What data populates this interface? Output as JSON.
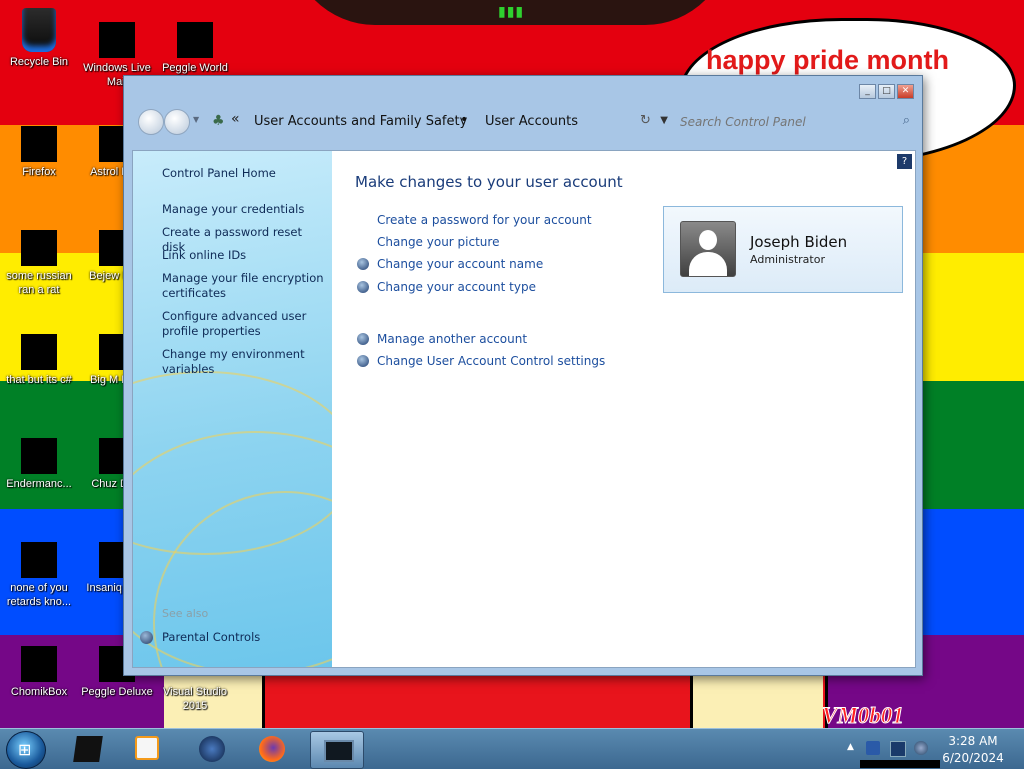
{
  "wallpaper": {
    "speech_text": "happy pride month",
    "signature": "VM0b01"
  },
  "desktop_icons": [
    {
      "label": "Recycle Bin",
      "icon": "recycle-bin-icon"
    },
    {
      "label": "Windows Live Mail",
      "icon": "mail-icon"
    },
    {
      "label": "Peggle World",
      "icon": "game-icon"
    },
    {
      "label": "Firefox",
      "icon": "firefox-icon"
    },
    {
      "label": "Astrol Delu",
      "icon": "game-icon"
    },
    {
      "label": "some russian ran a rat",
      "icon": "app-icon"
    },
    {
      "label": "Bejew Delu",
      "icon": "game-icon"
    },
    {
      "label": "that but its c#",
      "icon": "shortcut-icon"
    },
    {
      "label": "Big M Delu",
      "icon": "game-icon"
    },
    {
      "label": "Endermanc...",
      "icon": "app-icon"
    },
    {
      "label": "Chuz Delu",
      "icon": "game-icon"
    },
    {
      "label": "none of you retards kno...",
      "icon": "app-icon"
    },
    {
      "label": "Insaniq Delu",
      "icon": "game-icon"
    },
    {
      "label": "ChomikBox",
      "icon": "app-icon"
    },
    {
      "label": "Peggle Deluxe",
      "icon": "game-icon"
    },
    {
      "label": "Visual Studio 2015",
      "icon": "app-icon"
    }
  ],
  "window": {
    "address": {
      "crumb1": "User Accounts and Family Safety",
      "crumb2": "User Accounts"
    },
    "search_placeholder": "Search Control Panel",
    "left_pane": {
      "links": [
        "Control Panel Home",
        "Manage your credentials",
        "Create a password reset disk",
        "Link online IDs",
        "Manage your file encryption certificates",
        "Configure advanced user profile properties",
        "Change my environment variables"
      ],
      "see_also": "See also",
      "parental": "Parental Controls"
    },
    "main": {
      "heading": "Make changes to your user account",
      "actions": [
        "Create a password for your account",
        "Change your picture",
        "Change your account name",
        "Change your account type",
        "Manage another account",
        "Change User Account Control settings"
      ]
    },
    "user": {
      "name": "Joseph Biden",
      "role": "Administrator"
    }
  },
  "taskbar": {
    "time": "3:28 AM",
    "date": "6/20/2024"
  }
}
